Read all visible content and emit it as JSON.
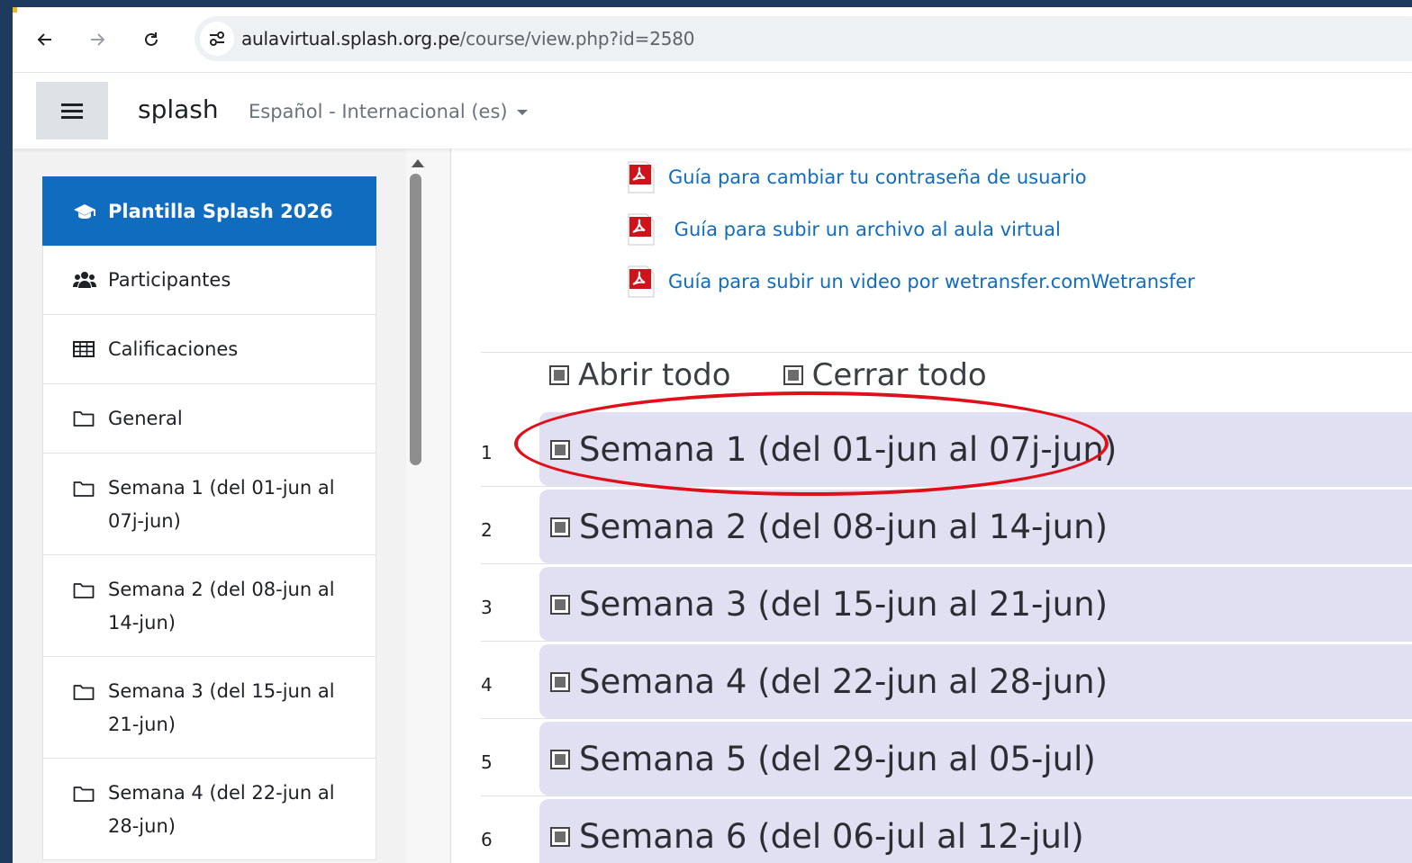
{
  "browser": {
    "url_domain": "aulavirtual.splash.org.pe",
    "url_path": "/course/view.php?id=2580",
    "back_icon": "arrow-left-icon",
    "forward_icon": "arrow-right-icon",
    "reload_icon": "reload-icon",
    "site_info_icon": "tune-icon"
  },
  "navbar": {
    "brand": "splash",
    "language": "Español - Internacional (es)"
  },
  "sidebar": {
    "items": [
      {
        "label": "Plantilla Splash 2026",
        "icon": "graduation-cap-icon",
        "active": true
      },
      {
        "label": "Participantes",
        "icon": "users-icon"
      },
      {
        "label": "Calificaciones",
        "icon": "table-icon"
      },
      {
        "label": "General",
        "icon": "folder-icon"
      },
      {
        "line1": "Semana 1 (del 01-jun al",
        "line2": "07j-jun)",
        "icon": "folder-icon"
      },
      {
        "line1": "Semana 2 (del 08-jun al",
        "line2": "14-jun)",
        "icon": "folder-icon"
      },
      {
        "line1": "Semana 3 (del 15-jun al",
        "line2": "21-jun)",
        "icon": "folder-icon"
      },
      {
        "line1": "Semana 4 (del 22-jun al",
        "line2": "28-jun)",
        "icon": "folder-icon"
      }
    ]
  },
  "main": {
    "resources": [
      {
        "label": "Guía para cambiar tu contraseña de usuario",
        "icon": "pdf-icon"
      },
      {
        "label": " Guía para subir un archivo al aula virtual",
        "icon": "pdf-icon"
      },
      {
        "label": "Guía para subir un video por wetransfer.comWetransfer",
        "icon": "pdf-icon"
      }
    ],
    "expand_all": "Abrir todo",
    "collapse_all": "Cerrar todo",
    "sections": [
      {
        "num": "1",
        "title": "Semana 1 (del 01-jun al 07j-jun)"
      },
      {
        "num": "2",
        "title": "Semana 2 (del 08-jun al 14-jun)"
      },
      {
        "num": "3",
        "title": "Semana 3 (del 15-jun al 21-jun)"
      },
      {
        "num": "4",
        "title": "Semana 4 (del 22-jun al 28-jun)"
      },
      {
        "num": "5",
        "title": "Semana 5 (del 29-jun al 05-jul)"
      },
      {
        "num": "6",
        "title": "Semana 6 (del 06-jul al 12-jul)"
      }
    ]
  },
  "colors": {
    "accent": "#0f6cbf",
    "section_band": "#e1e0f3",
    "highlight": "#e0101a",
    "background": "#1e3a5f"
  }
}
